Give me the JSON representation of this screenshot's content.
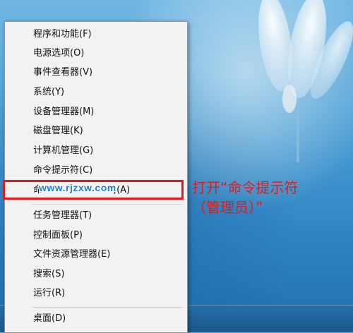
{
  "context_menu": {
    "items": [
      "程序和功能(F)",
      "电源选项(O)",
      "事件查看器(V)",
      "系统(Y)",
      "设备管理器(M)",
      "磁盘管理(K)",
      "计算机管理(G)",
      "命令提示符(C)",
      "命令提示符(管理员)(A)",
      "任务管理器(T)",
      "控制面板(P)",
      "文件资源管理器(E)",
      "搜索(S)",
      "运行(R)",
      "桌面(D)"
    ],
    "highlighted_visible_suffix": ")(A)",
    "highlighted_visible_prefix": "命"
  },
  "overlay": {
    "watermark": "www.rjzxw.com",
    "annotation_line1": "打开“命令提示符",
    "annotation_line2": "（管理员）”",
    "highlight_color": "#e01b1b"
  }
}
